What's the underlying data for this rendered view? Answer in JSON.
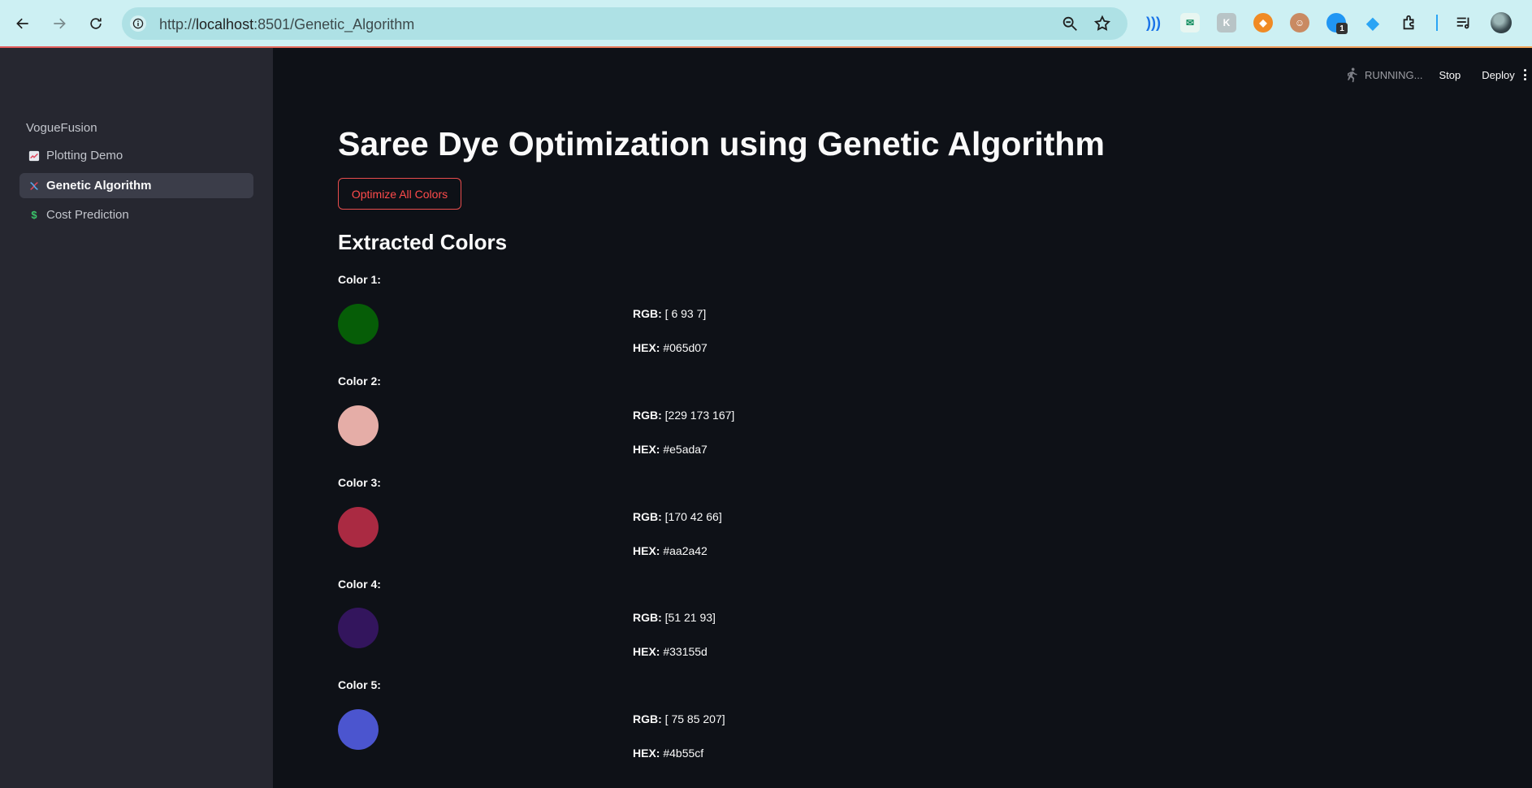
{
  "browser": {
    "url_prefix": "http://",
    "url_host": "localhost",
    "url_rest": ":8501/Genetic_Algorithm",
    "ext_badge": "1"
  },
  "sidebar": {
    "brand": "VogueFusion",
    "items": [
      {
        "label": "Plotting Demo",
        "icon": "chart-icon",
        "active": false
      },
      {
        "label": "Genetic Algorithm",
        "icon": "dna-icon",
        "active": true
      },
      {
        "label": "Cost Prediction",
        "icon": "dollar-icon",
        "active": false
      }
    ]
  },
  "header": {
    "status": "RUNNING...",
    "stop_label": "Stop",
    "deploy_label": "Deploy"
  },
  "main": {
    "title": "Saree Dye Optimization using Genetic Algorithm",
    "optimize_button": "Optimize All Colors",
    "subheading": "Extracted Colors",
    "rgb_key": "RGB:",
    "hex_key": "HEX:",
    "colors": [
      {
        "label": "Color 1:",
        "rgb": "[ 6 93 7]",
        "hex": "#065d07"
      },
      {
        "label": "Color 2:",
        "rgb": "[229 173 167]",
        "hex": "#e5ada7"
      },
      {
        "label": "Color 3:",
        "rgb": "[170 42 66]",
        "hex": "#aa2a42"
      },
      {
        "label": "Color 4:",
        "rgb": "[51 21 93]",
        "hex": "#33155d"
      },
      {
        "label": "Color 5:",
        "rgb": "[ 75 85 207]",
        "hex": "#4b55cf"
      }
    ]
  },
  "theme": {
    "accent": "#ff4b4b",
    "sidebar_bg": "#262730",
    "main_bg": "#0e1117"
  }
}
